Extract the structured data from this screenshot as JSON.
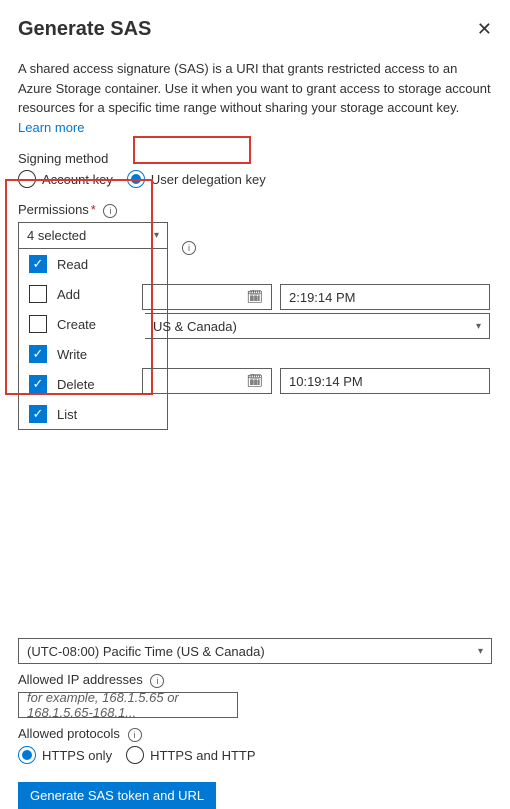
{
  "header": {
    "title": "Generate SAS"
  },
  "description": {
    "text": "A shared access signature (SAS) is a URI that grants restricted access to an Azure Storage container. Use it when you want to grant access to storage account resources for a specific time range without sharing your storage account key.",
    "learn_more": "Learn more"
  },
  "signing_method": {
    "label": "Signing method",
    "options": {
      "account_key": "Account key",
      "user_delegation": "User delegation key"
    },
    "selected": "user_delegation"
  },
  "permissions": {
    "label": "Permissions",
    "summary": "4 selected",
    "items": [
      {
        "label": "Read",
        "checked": true
      },
      {
        "label": "Add",
        "checked": false
      },
      {
        "label": "Create",
        "checked": false
      },
      {
        "label": "Write",
        "checked": true
      },
      {
        "label": "Delete",
        "checked": true
      },
      {
        "label": "List",
        "checked": true
      }
    ]
  },
  "start": {
    "time": "2:19:14 PM",
    "tz_partial": "US & Canada)"
  },
  "expiry": {
    "time": "10:19:14 PM",
    "tz": "(UTC-08:00) Pacific Time (US & Canada)"
  },
  "allowed_ip": {
    "label": "Allowed IP addresses",
    "placeholder": "for example, 168.1.5.65 or 168.1.5.65-168.1..."
  },
  "protocols": {
    "label": "Allowed protocols",
    "https_only": "HTTPS only",
    "https_http": "HTTPS and HTTP",
    "selected": "https_only"
  },
  "submit": {
    "label": "Generate SAS token and URL"
  },
  "info_glyph": "i"
}
